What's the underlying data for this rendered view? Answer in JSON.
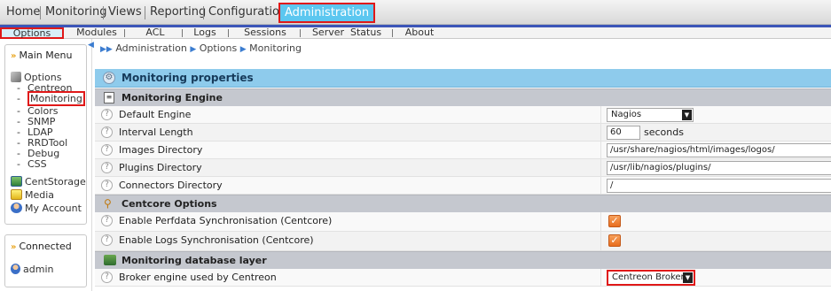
{
  "topnav": {
    "tabs": [
      {
        "label": "Home"
      },
      {
        "label": "Monitoring"
      },
      {
        "label": "Views"
      },
      {
        "label": "Reporting"
      },
      {
        "label": "Configuration"
      },
      {
        "label": "Administration",
        "active": true
      }
    ]
  },
  "subnav": {
    "tabs": [
      {
        "label": "Options",
        "active": true
      },
      {
        "label": "Modules"
      },
      {
        "label": "ACL"
      },
      {
        "label": "Logs"
      },
      {
        "label": "Sessions"
      },
      {
        "label": "Server  Status"
      },
      {
        "label": "About"
      }
    ]
  },
  "breadcrumb": [
    "Administration",
    "Options",
    "Monitoring"
  ],
  "sidebar": {
    "main_menu_title": "Main Menu",
    "options_label": "Options",
    "option_items": [
      "Centreon",
      "Monitoring",
      "Colors",
      "SNMP",
      "LDAP",
      "RRDTool",
      "Debug",
      "CSS"
    ],
    "selected_item": "Monitoring",
    "other_items": [
      "CentStorage",
      "Media",
      "My Account"
    ],
    "connected_title": "Connected",
    "user": "admin"
  },
  "form": {
    "title": "Monitoring properties",
    "engine_section": "Monitoring Engine",
    "default_engine_label": "Default Engine",
    "default_engine_value": "Nagios",
    "interval_label": "Interval Length",
    "interval_value": "60",
    "interval_unit": "seconds",
    "images_dir_label": "Images Directory",
    "images_dir_value": "/usr/share/nagios/html/images/logos/",
    "plugins_dir_label": "Plugins Directory",
    "plugins_dir_value": "/usr/lib/nagios/plugins/",
    "connectors_dir_label": "Connectors Directory",
    "connectors_dir_value": "/",
    "centcore_section": "Centcore Options",
    "perfdata_sync_label": "Enable Perfdata Synchronisation (Centcore)",
    "perfdata_sync_checked": true,
    "logs_sync_label": "Enable Logs Synchronisation (Centcore)",
    "logs_sync_checked": true,
    "db_section": "Monitoring database layer",
    "broker_label": "Broker engine used by Centreon",
    "broker_value": "Centreon Broker",
    "help_glyph": "?",
    "check_glyph": "✓"
  },
  "colors": {
    "accent_blue": "#3c55b8",
    "active_tab_bg": "#5cc7f0",
    "highlight_red": "#e01818",
    "header_blue": "#8ecbec",
    "checkbox_orange": "#e86e1e"
  }
}
